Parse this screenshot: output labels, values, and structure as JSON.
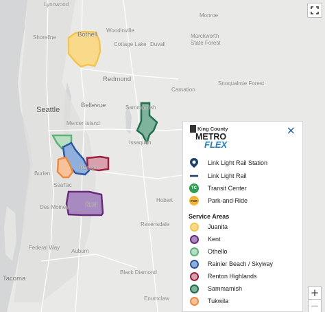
{
  "map": {
    "places": [
      {
        "name": "Lynnwood"
      },
      {
        "name": "Shoreline"
      },
      {
        "name": "Bothell"
      },
      {
        "name": "Woodinville"
      },
      {
        "name": "Monroe"
      },
      {
        "name": "Cottage Lake"
      },
      {
        "name": "Duvall"
      },
      {
        "name": "Marckworth State Forest"
      },
      {
        "name": "Redmond"
      },
      {
        "name": "Carnation"
      },
      {
        "name": "Snoqualmie Forest"
      },
      {
        "name": "Seattle"
      },
      {
        "name": "Bellevue"
      },
      {
        "name": "Mercer Island"
      },
      {
        "name": "Sammamish"
      },
      {
        "name": "Issaquah"
      },
      {
        "name": "Burien"
      },
      {
        "name": "Renton"
      },
      {
        "name": "SeaTac"
      },
      {
        "name": "Des Moines"
      },
      {
        "name": "Kent"
      },
      {
        "name": "Hobart"
      },
      {
        "name": "Federal Way"
      },
      {
        "name": "Auburn"
      },
      {
        "name": "Ravensdale"
      },
      {
        "name": "Tacoma"
      },
      {
        "name": "Enumclaw"
      },
      {
        "name": "Black Diamond"
      }
    ],
    "service_area_shapes": [
      {
        "area": "Juanita",
        "color": "#f5c44a",
        "fill": "#f9d98a"
      },
      {
        "area": "Kent",
        "color": "#6a2a7e",
        "fill": "#a98ac0"
      },
      {
        "area": "Othello",
        "color": "#5bb37a",
        "fill": "#b8dfc2"
      },
      {
        "area": "Rainier Beach / Skyway",
        "color": "#2a56a4",
        "fill": "#8fb0dc"
      },
      {
        "area": "Renton Highlands",
        "color": "#9b1f3a",
        "fill": "#d7a0ac"
      },
      {
        "area": "Sammamish",
        "color": "#1f6e4e",
        "fill": "#7fb39c"
      },
      {
        "area": "Tukwila",
        "color": "#ef8a3c",
        "fill": "#f7c29a"
      }
    ]
  },
  "controls": {
    "fullscreen_icon": "fullscreen-icon",
    "zoom_in": "+",
    "zoom_out": "−"
  },
  "legend": {
    "logo": {
      "line1": "King County",
      "line2": "METRO",
      "line3": "FLEX"
    },
    "close": "×",
    "items": [
      {
        "label": "Link Light Rail Station",
        "icon": "rail-station-icon"
      },
      {
        "label": "Link Light Rail",
        "icon": "rail-line-icon"
      },
      {
        "label": "Transit Center",
        "icon": "transit-center-icon",
        "glyph": "TC"
      },
      {
        "label": "Park-and-Ride",
        "icon": "park-and-ride-icon",
        "glyph": "P&R"
      }
    ],
    "service_areas_heading": "Service Areas",
    "service_areas": [
      {
        "label": "Juanita",
        "color": "#f5c44a",
        "fill": "#f9d98a"
      },
      {
        "label": "Kent",
        "color": "#6a2a7e",
        "fill": "#a98ac0"
      },
      {
        "label": "Othello",
        "color": "#5bb37a",
        "fill": "#b8dfc2"
      },
      {
        "label": "Rainier Beach / Skyway",
        "color": "#2a56a4",
        "fill": "#8fb0dc"
      },
      {
        "label": "Renton Highlands",
        "color": "#9b1f3a",
        "fill": "#d7a0ac"
      },
      {
        "label": "Sammamish",
        "color": "#1f6e4e",
        "fill": "#7fb39c"
      },
      {
        "label": "Tukwila",
        "color": "#ef8a3c",
        "fill": "#f7c29a"
      }
    ]
  }
}
